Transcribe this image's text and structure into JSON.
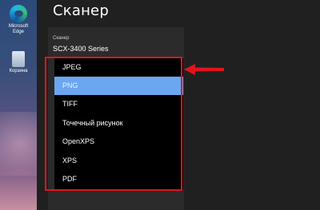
{
  "desktop": {
    "icons": [
      {
        "label": "Microsoft Edge",
        "icon": "edge-icon"
      },
      {
        "label": "Корзина",
        "icon": "recycle-bin-icon"
      }
    ]
  },
  "window": {
    "title": "Сканер"
  },
  "scanner": {
    "label": "Сканер",
    "name": "SCX-3400 Series"
  },
  "file_type_dropdown": {
    "selected": "PNG",
    "options": [
      "JPEG",
      "PNG",
      "TIFF",
      "Точечный рисунок",
      "OpenXPS",
      "XPS",
      "PDF"
    ]
  },
  "annotation": {
    "highlight_color": "#e0141e",
    "selection_color": "#6aa7f0"
  }
}
